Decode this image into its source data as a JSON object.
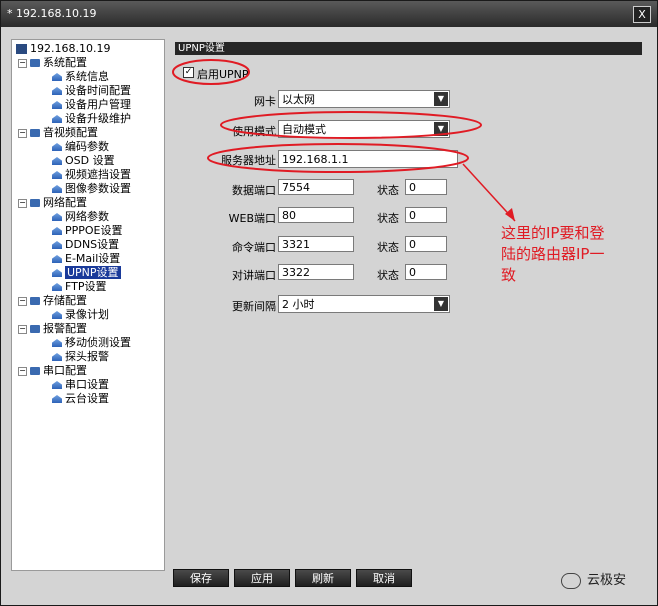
{
  "window": {
    "title": "* 192.168.10.19",
    "close_label": "X"
  },
  "tree": {
    "root": "192.168.10.19",
    "groups": [
      {
        "label": "系统配置",
        "items": [
          "系统信息",
          "设备时间配置",
          "设备用户管理",
          "设备升级维护"
        ]
      },
      {
        "label": "音视频配置",
        "items": [
          "编码参数",
          "OSD 设置",
          "视频遮挡设置",
          "图像参数设置"
        ]
      },
      {
        "label": "网络配置",
        "items": [
          "网络参数",
          "PPPOE设置",
          "DDNS设置",
          "E-Mail设置",
          "UPNP设置",
          "FTP设置"
        ]
      },
      {
        "label": "存储配置",
        "items": [
          "录像计划"
        ]
      },
      {
        "label": "报警配置",
        "items": [
          "移动侦测设置",
          "探头报警"
        ]
      },
      {
        "label": "串口配置",
        "items": [
          "串口设置",
          "云台设置"
        ]
      }
    ]
  },
  "panel": {
    "title": "UPNP设置",
    "enable_label": "启用UPNP",
    "enable_checked": "✓",
    "nic_label": "网卡",
    "nic_value": "以太网",
    "mode_label": "使用模式",
    "mode_value": "自动模式",
    "server_label": "服务器地址",
    "server_value": "192.168.1.1",
    "ports": [
      {
        "label": "数据端口",
        "value": "7554",
        "status_label": "状态",
        "status": "0"
      },
      {
        "label": "WEB端口",
        "value": "80",
        "status_label": "状态",
        "status": "0"
      },
      {
        "label": "命令端口",
        "value": "3321",
        "status_label": "状态",
        "status": "0"
      },
      {
        "label": "对讲端口",
        "value": "3322",
        "status_label": "状态",
        "status": "0"
      }
    ],
    "interval_label": "更新间隔",
    "interval_value": "2 小时"
  },
  "buttons": {
    "save": "保存",
    "apply": "应用",
    "refresh": "刷新",
    "cancel": "取消"
  },
  "annotation": {
    "line1": "这里的IP要和登",
    "line2": "陆的路由器IP一",
    "line3": "致"
  },
  "watermark": "云极安",
  "colors": {
    "annotation": "#e01b24",
    "selection": "#1a3a9a"
  }
}
